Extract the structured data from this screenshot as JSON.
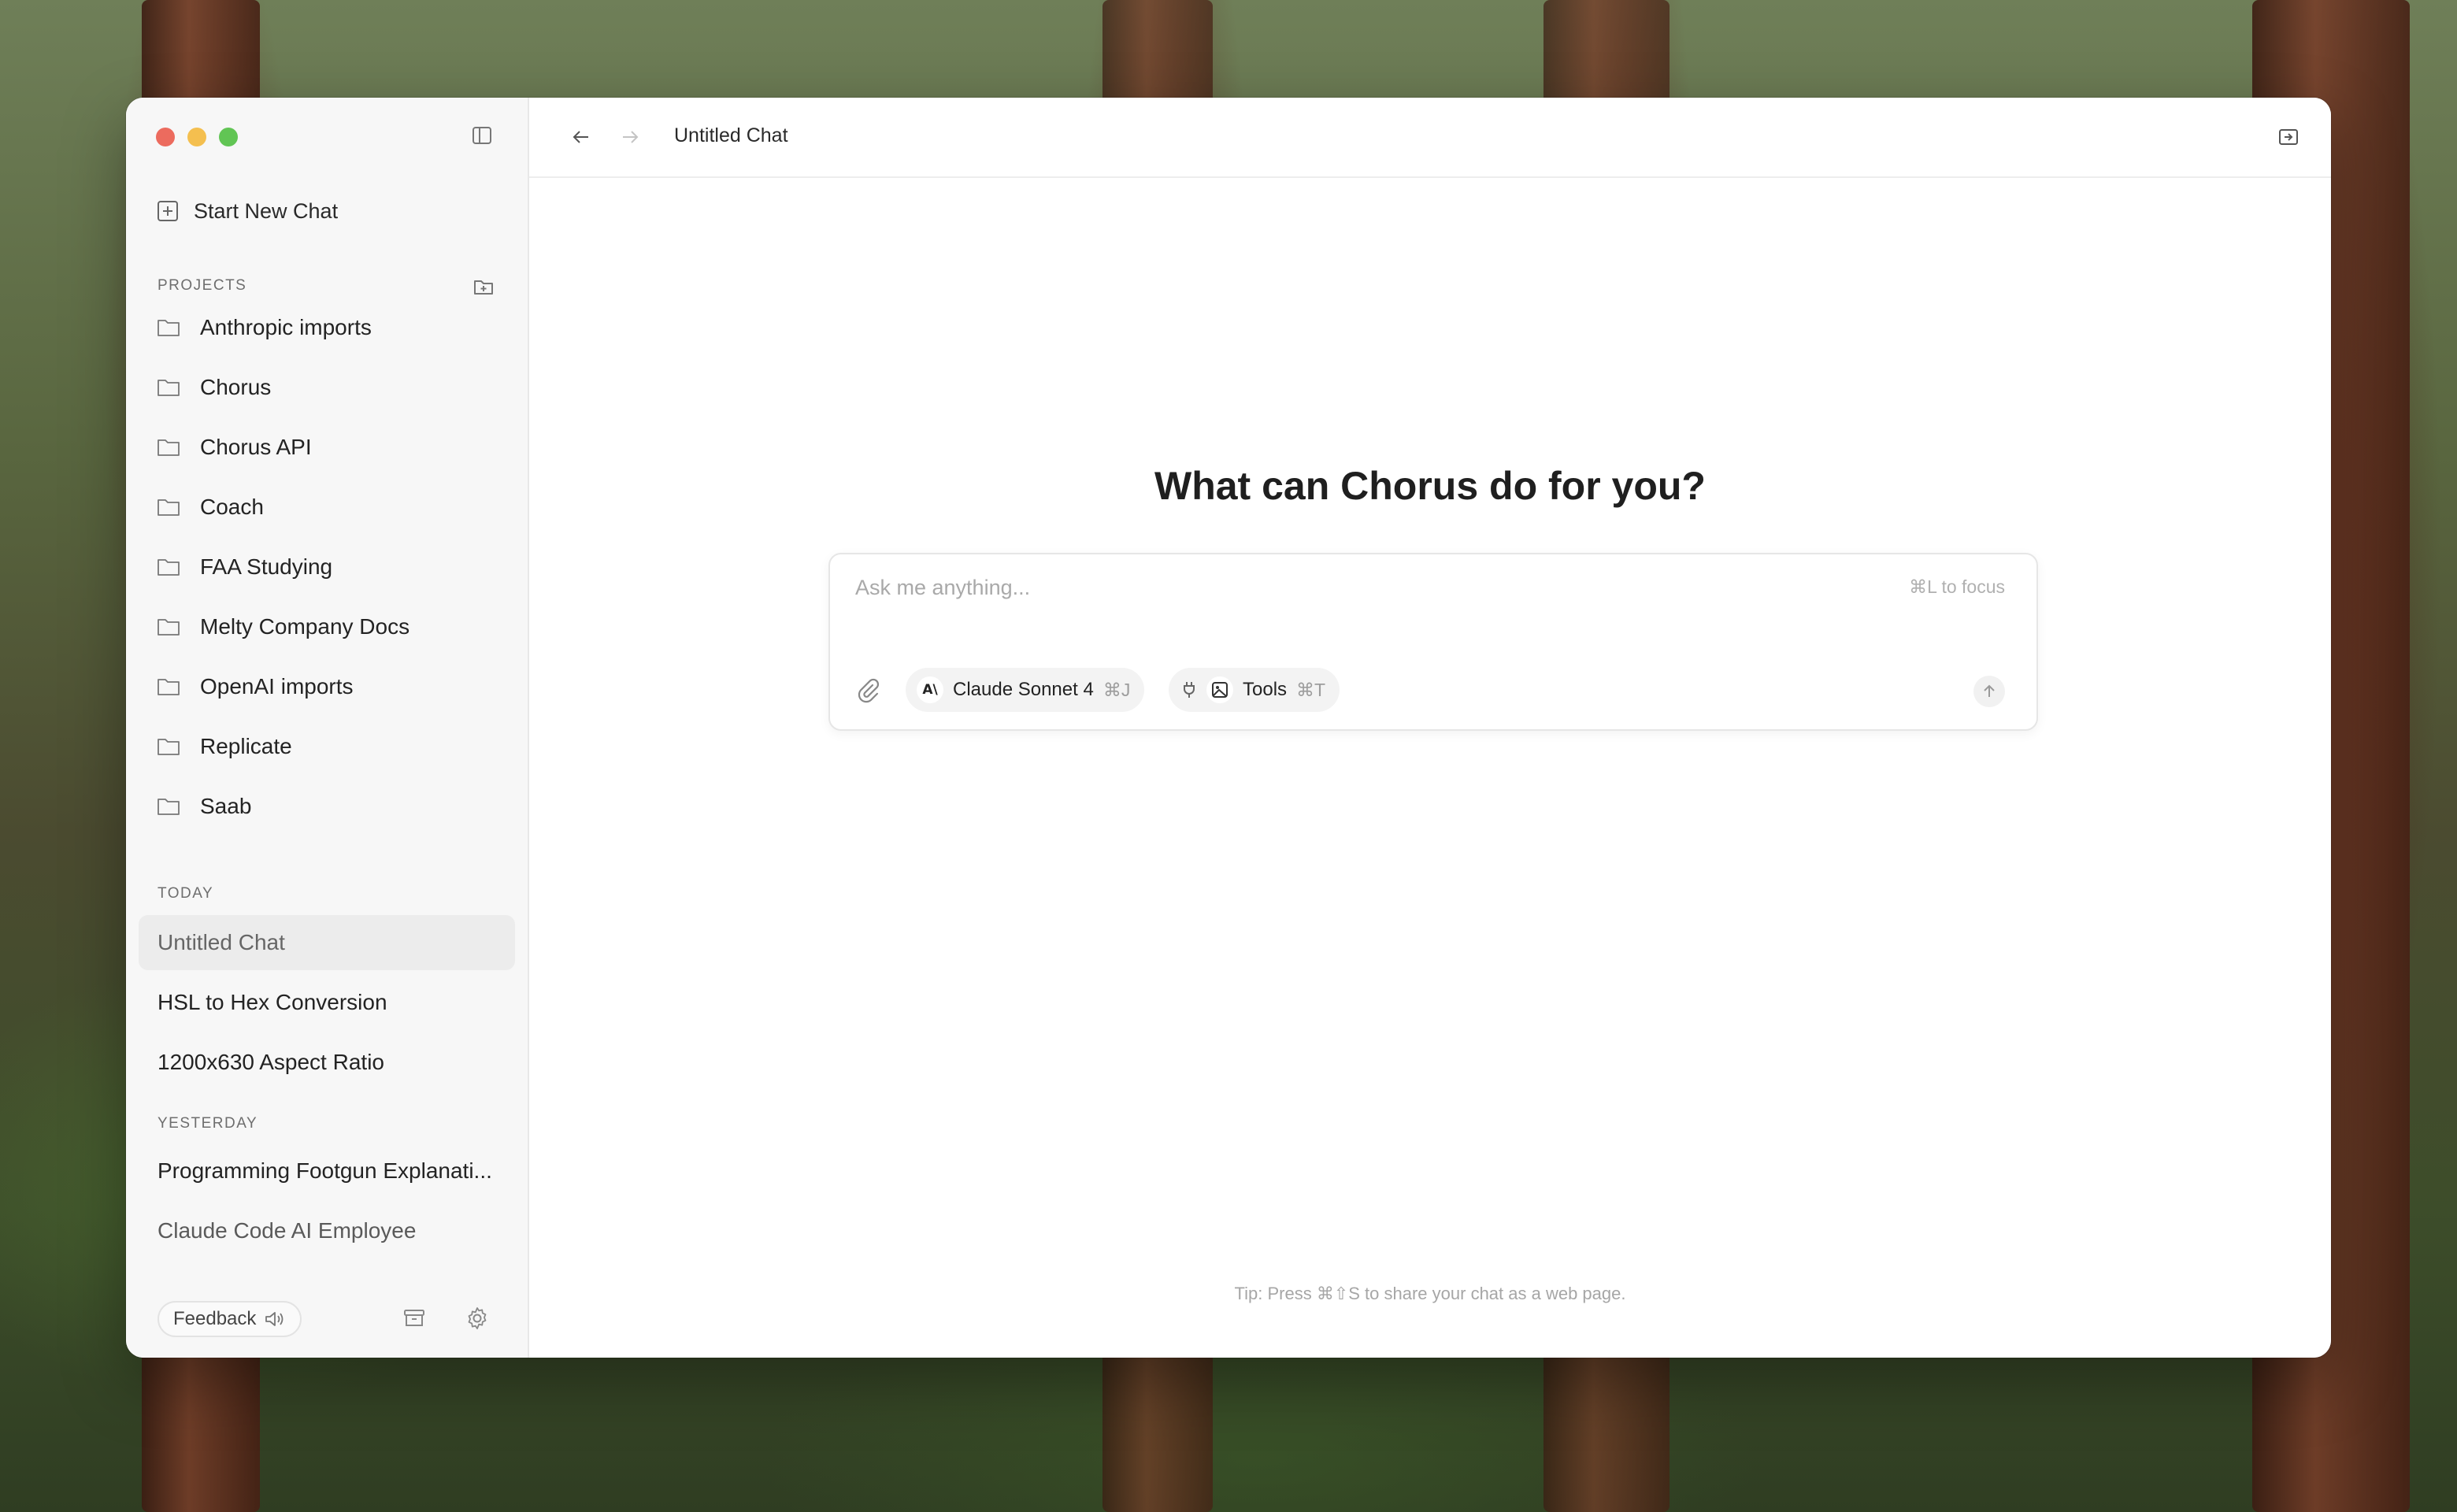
{
  "window": {
    "traffic_lights": {
      "close": "#ec6b5e",
      "minimize": "#f4bf4f",
      "zoom": "#61c554"
    }
  },
  "sidebar": {
    "new_chat_label": "Start New Chat",
    "projects_heading": "PROJECTS",
    "projects": [
      {
        "label": "Anthropic imports"
      },
      {
        "label": "Chorus"
      },
      {
        "label": "Chorus API"
      },
      {
        "label": "Coach"
      },
      {
        "label": "FAA Studying"
      },
      {
        "label": "Melty Company Docs"
      },
      {
        "label": "OpenAI imports"
      },
      {
        "label": "Replicate"
      },
      {
        "label": "Saab"
      }
    ],
    "today_heading": "TODAY",
    "today_chats": [
      {
        "label": "Untitled Chat",
        "active": true
      },
      {
        "label": "HSL to Hex Conversion"
      },
      {
        "label": "1200x630 Aspect Ratio"
      }
    ],
    "yesterday_heading": "YESTERDAY",
    "yesterday_chats": [
      {
        "label": "Programming Footgun Explanati..."
      },
      {
        "label": "Claude Code AI Employee"
      }
    ],
    "feedback_label": "Feedback"
  },
  "topbar": {
    "chat_title": "Untitled Chat"
  },
  "main": {
    "headline": "What can Chorus do for you?",
    "composer": {
      "placeholder": "Ask me anything...",
      "focus_hint": "⌘L to focus",
      "model_label": "Claude Sonnet 4",
      "model_shortcut": "⌘J",
      "tools_label": "Tools",
      "tools_shortcut": "⌘T"
    },
    "tip": "Tip: Press ⌘⇧S to share your chat as a web page."
  },
  "icons": {
    "sidebar_toggle": "sidebar-toggle-icon",
    "new_chat": "plus-square-icon",
    "add_project": "folder-plus-icon",
    "project": "folder-icon",
    "back": "arrow-left-icon",
    "forward": "arrow-right-icon",
    "share": "share-icon",
    "attach": "paperclip-icon",
    "model": "anthropic-logo-icon",
    "plugin": "plug-icon",
    "image": "image-icon",
    "send": "arrow-up-icon",
    "speaker": "speaker-icon",
    "archive": "archive-icon",
    "settings": "gear-icon"
  }
}
